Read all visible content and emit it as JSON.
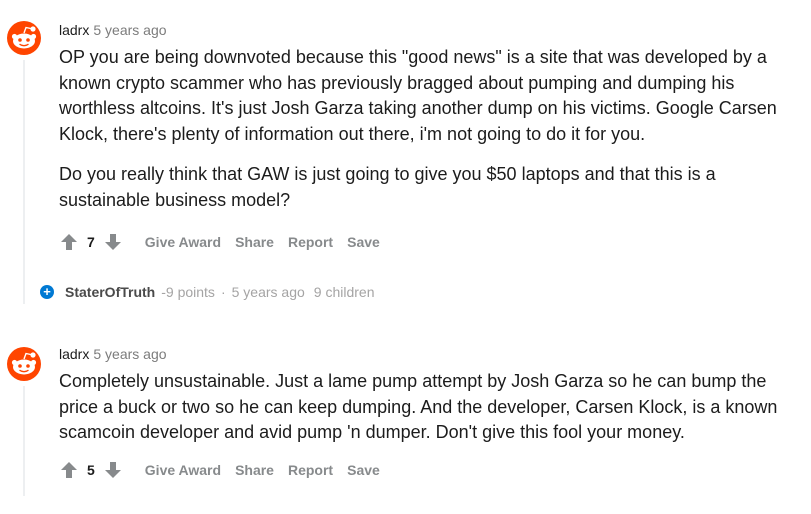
{
  "comments": [
    {
      "author": "ladrx",
      "time": "5 years ago",
      "paragraphs": [
        "OP you are being downvoted because this \"good news\" is a site that was developed by a known crypto scammer who has previously bragged about pumping and dumping his worthless altcoins. It's just Josh Garza taking another dump on his victims. Google Carsen Klock, there's plenty of information out there, i'm not going to do it for you.",
        "Do you really think that GAW is just going to give you $50 laptops and that this is a sustainable business model?"
      ],
      "score": "7",
      "actions": [
        "Give Award",
        "Share",
        "Report",
        "Save"
      ]
    },
    {
      "author": "ladrx",
      "time": "5 years ago",
      "paragraphs": [
        "Completely unsustainable. Just a lame pump attempt by Josh Garza so he can bump the price a buck or two so he can keep dumping. And the developer, Carsen Klock, is a known scamcoin developer and avid pump 'n dumper. Don't give this fool your money."
      ],
      "score": "5",
      "actions": [
        "Give Award",
        "Share",
        "Report",
        "Save"
      ]
    }
  ],
  "collapsed_reply": {
    "expand_symbol": "+",
    "author": "StaterOfTruth",
    "points": "-9 points",
    "separator": "·",
    "time": "5 years ago",
    "children": "9 children"
  },
  "icons": {
    "avatar": "reddit-snoo-avatar",
    "upvote": "upvote-arrow-icon",
    "downvote": "downvote-arrow-icon"
  },
  "colors": {
    "snoo_orange": "#ff4500",
    "expand_blue": "#0079d3",
    "action_gray": "#878a8c",
    "meta_gray": "#7c7c7c"
  }
}
